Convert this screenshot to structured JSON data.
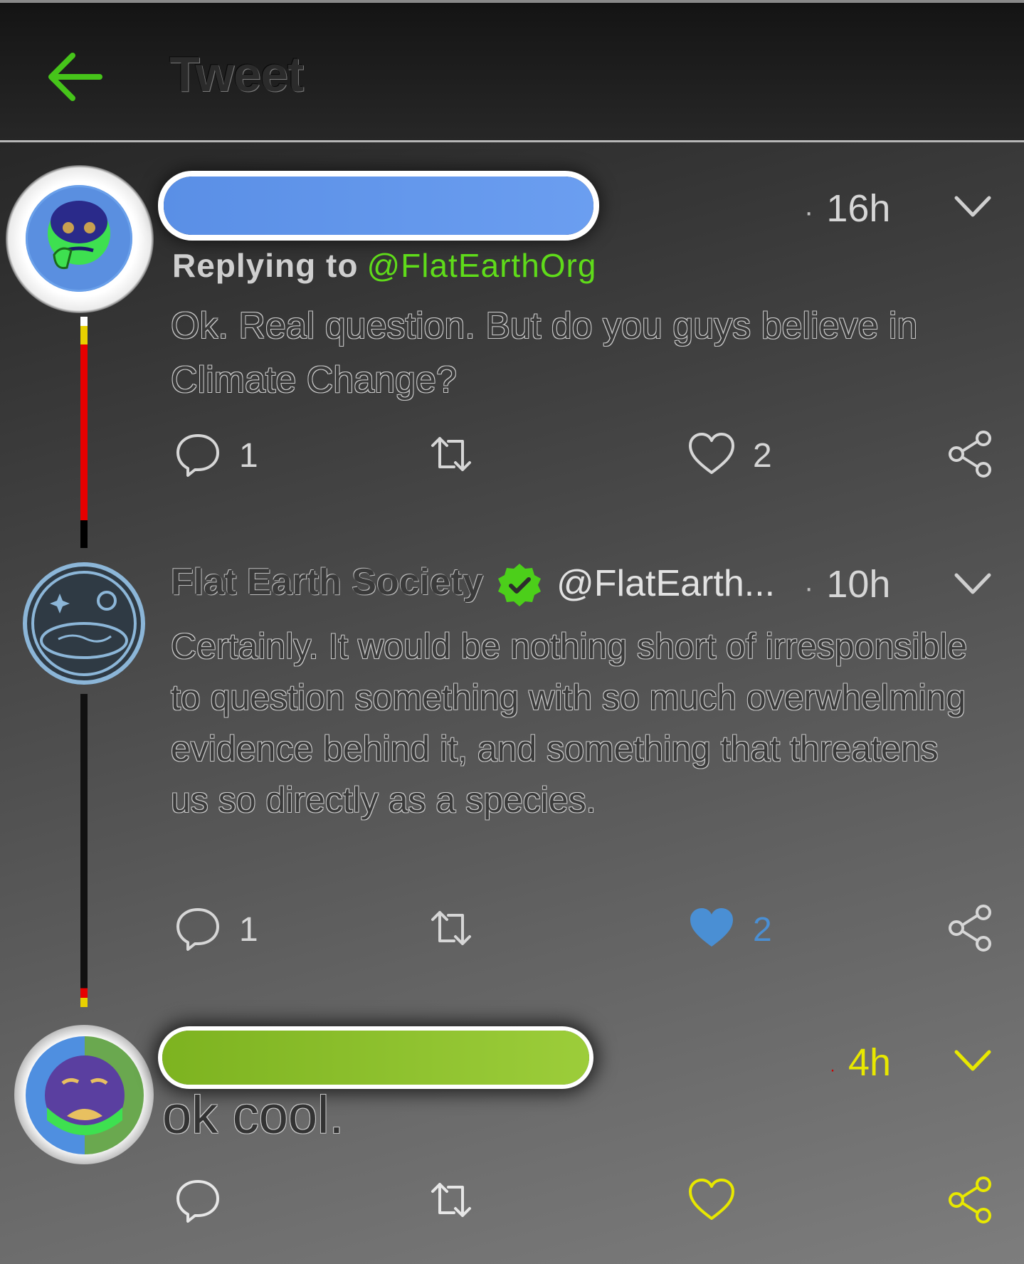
{
  "header": {
    "title": "Tweet",
    "back_icon": "arrow-left-icon"
  },
  "colors": {
    "accent_green": "#46c41a",
    "liked_blue": "#4a8fd4",
    "yellow": "#e8e800",
    "text_light": "#d6d6d6"
  },
  "tweets": [
    {
      "author_redacted": true,
      "timestamp": "16h",
      "replying_label": "Replying to",
      "replying_handle": "@FlatEarthOrg",
      "text": "Ok. Real question. But do you guys believe in Climate Change?",
      "actions": {
        "reply_count": "1",
        "retweet_count": "",
        "like_count": "2",
        "liked": false
      }
    },
    {
      "author_name": "Flat Earth Society",
      "author_handle": "@FlatEarth...",
      "verified": true,
      "timestamp": "10h",
      "text": "Certainly. It would be nothing short of irresponsible to question something with so much overwhelming evidence behind it, and something that threatens us so directly as a species.",
      "actions": {
        "reply_count": "1",
        "retweet_count": "",
        "like_count": "2",
        "liked": true
      }
    },
    {
      "author_redacted": true,
      "timestamp": "4h",
      "text": "ok cool.",
      "actions": {
        "reply_count": "",
        "retweet_count": "",
        "like_count": "",
        "liked": false
      }
    }
  ]
}
